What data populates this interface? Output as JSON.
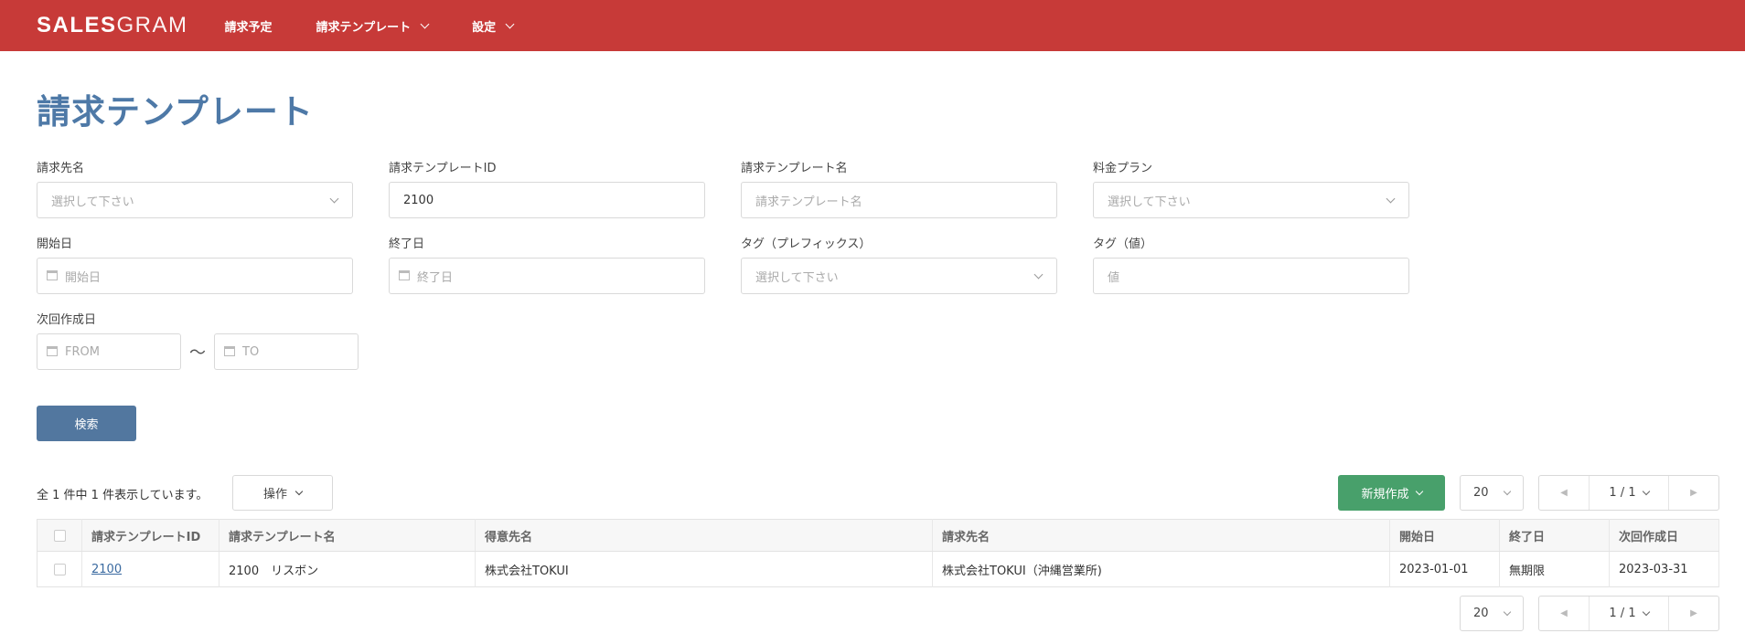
{
  "header": {
    "logo_bold": "SALES",
    "logo_light": "GRAM",
    "nav": [
      {
        "label": "請求予定"
      },
      {
        "label": "請求テンプレート"
      },
      {
        "label": "設定"
      }
    ]
  },
  "page_title": "請求テンプレート",
  "form": {
    "billing_to": {
      "label": "請求先名",
      "placeholder": "選択して下さい"
    },
    "template_id": {
      "label": "請求テンプレートID",
      "value": "2100"
    },
    "template_name": {
      "label": "請求テンプレート名",
      "placeholder": "請求テンプレート名"
    },
    "plan": {
      "label": "料金プラン",
      "placeholder": "選択して下さい"
    },
    "start_date": {
      "label": "開始日",
      "placeholder": "開始日"
    },
    "end_date": {
      "label": "終了日",
      "placeholder": "終了日"
    },
    "tag_prefix": {
      "label": "タグ（プレフィックス）",
      "placeholder": "選択して下さい"
    },
    "tag_value": {
      "label": "タグ（値）",
      "placeholder": "値"
    },
    "next_date": {
      "label": "次回作成日",
      "from_placeholder": "FROM",
      "tilde": "〜",
      "to_placeholder": "TO"
    },
    "search_label": "検索"
  },
  "toolbar": {
    "count_text": "全 1 件中 1 件表示しています。",
    "ops_label": "操作",
    "new_label": "新規作成",
    "per_page": "20",
    "page_display": "1 / 1",
    "prev_icon": "caret-left-icon",
    "next_icon": "caret-right-icon"
  },
  "table": {
    "headers": [
      "請求テンプレートID",
      "請求テンプレート名",
      "得意先名",
      "請求先名",
      "開始日",
      "終了日",
      "次回作成日"
    ],
    "rows": [
      {
        "id": "2100",
        "name": "2100　リスボン",
        "customer": "株式会社TOKUI",
        "billing_to": "株式会社TOKUI（沖縄営業所)",
        "start": "2023-01-01",
        "end": "無期限",
        "next": "2023-03-31"
      }
    ]
  },
  "colors": {
    "header_bg": "#c73a38",
    "title": "#4e79a7",
    "search_btn": "#52779f",
    "new_btn": "#48a06b"
  }
}
